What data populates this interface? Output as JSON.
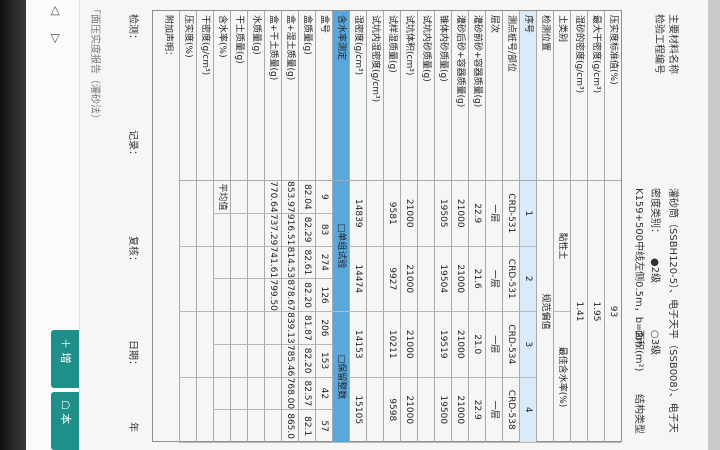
{
  "doc": {
    "title": "「面压实度报告（灌砂法）"
  },
  "toolbar": {
    "icon_back": "◁",
    "icon_forward": "▷",
    "btn_add": "＋ 增",
    "btn_local": "☖ 本"
  },
  "header": {
    "unit_name": "主要材料名称",
    "unit_no": "检验工程编号",
    "instrument": "灌砂筒（SSBH120-5）、电子天平（SSB008）、电子天",
    "method_label": "密度类别：",
    "opt1": "●2级",
    "opt2": "○3级",
    "sample_desc": "K159+500中线左侧0.5m，b=2m",
    "area": "面积(m²)",
    "area_val": "结构类型"
  },
  "rows": [
    {
      "label": "压实度标准值(%)",
      "cells": [
        "93"
      ],
      "style": ""
    },
    {
      "label": "最大干密度(g/cm³)",
      "cells": [
        "1.95"
      ],
      "style": ""
    },
    {
      "label": "湿砂的密度(g/cm³)",
      "cells": [
        "1.41"
      ],
      "style": ""
    },
    {
      "label": "土类别",
      "cells": [
        "黏性土",
        "最佳含水率(%)"
      ],
      "style": ""
    },
    {
      "label": "检测位置",
      "cells": [
        "规范偏值"
      ],
      "style": ""
    },
    {
      "label": "序号",
      "cells": [
        "1",
        "2",
        "3",
        "4"
      ],
      "style": "light"
    },
    {
      "label": "测点桩号/部位",
      "cells": [
        "CRD-531",
        "CRD-531",
        "CRD-534",
        "CRD-538"
      ],
      "style": ""
    },
    {
      "label": "层次",
      "cells": [
        "一层",
        "一层",
        "一层",
        "一层"
      ],
      "style": ""
    },
    {
      "label": "灌砂前砂+容器质量(g)",
      "cells": [
        "22.9",
        "21.6",
        "21.0",
        "22.9"
      ],
      "style": ""
    },
    {
      "label": "灌砂后砂+容器质量(g)",
      "cells": [
        "21000",
        "21000",
        "21000",
        "21000"
      ],
      "style": ""
    },
    {
      "label": "锥体内砂质量(g)",
      "cells": [
        "19505",
        "19504",
        "19519",
        "19500"
      ],
      "style": ""
    },
    {
      "label": "试坑内砂质量(g)",
      "cells": [
        "",
        "",
        "",
        ""
      ],
      "style": ""
    },
    {
      "label": "试坑体积(cm³)",
      "cells": [
        "21000",
        "21000",
        "21000",
        "21000"
      ],
      "style": ""
    },
    {
      "label": "试样湿质量(g)",
      "cells": [
        "9581",
        "9927",
        "10211",
        "9598"
      ],
      "style": ""
    },
    {
      "label": "试坑内湿密度(g/cm³)",
      "cells": [
        "",
        "",
        "",
        ""
      ],
      "style": ""
    },
    {
      "label": "湿密度(g/cm³)",
      "cells": [
        "14839",
        "14474",
        "14153",
        "15105"
      ],
      "style": ""
    },
    {
      "label": "含水率测定",
      "cells": [
        "□单组试验",
        "□保留整数"
      ],
      "style": "blue"
    },
    {
      "label": "盒号",
      "cells": [
        "9",
        "83",
        "274",
        "126",
        "206",
        "153",
        "42",
        "57"
      ],
      "style": ""
    },
    {
      "label": "盒质量(g)",
      "cells": [
        "82.04",
        "82.29",
        "82.61",
        "82.20",
        "81.87",
        "82.20",
        "82.57",
        "82.1"
      ],
      "style": ""
    },
    {
      "label": "盒+湿土质量(g)",
      "cells": [
        "853.97",
        "916.51",
        "814.53",
        "878.67",
        "839.13",
        "785.46",
        "768.00",
        "865.0"
      ],
      "style": ""
    },
    {
      "label": "盒+干土质量(g)",
      "cells": [
        "770.64",
        "737.29",
        "741.61",
        "799.50",
        "",
        "",
        "",
        ""
      ],
      "style": ""
    },
    {
      "label": "水质量(g)",
      "cells": [
        "",
        "",
        "",
        "",
        "",
        "",
        "",
        ""
      ],
      "style": ""
    },
    {
      "label": "干土质量(g)",
      "cells": [
        "",
        "",
        "",
        "",
        "",
        "",
        "",
        ""
      ],
      "style": ""
    },
    {
      "label": "含水率(%)",
      "cells": [
        "平均值",
        "",
        "",
        "",
        "",
        "",
        "",
        ""
      ],
      "style": ""
    },
    {
      "label": "干密度(g/cm³)",
      "cells": [
        "",
        "",
        "",
        ""
      ],
      "style": ""
    },
    {
      "label": "压实度(%)",
      "cells": [
        "",
        "",
        "",
        ""
      ],
      "style": ""
    }
  ],
  "notes": {
    "label": "附加声明："
  },
  "footer": {
    "tester": "检测：",
    "recorder": "记录：",
    "reviewer": "复核：",
    "date": "日期：",
    "year": "年"
  }
}
